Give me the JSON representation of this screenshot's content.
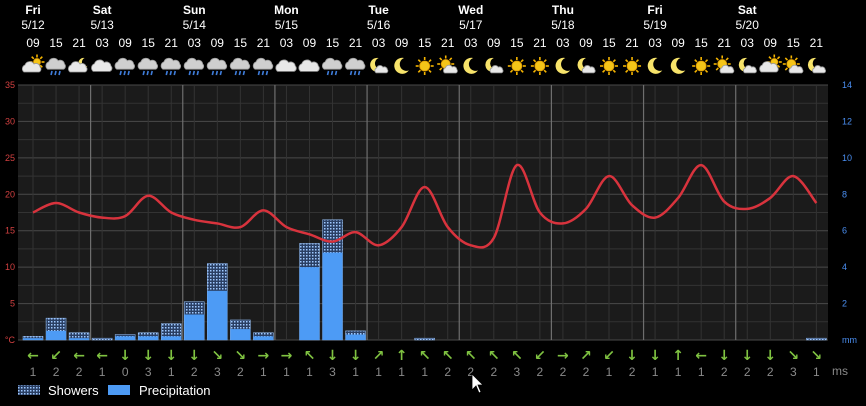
{
  "days": [
    {
      "name": "Fri",
      "date": "5/12"
    },
    {
      "name": "Sat",
      "date": "5/13"
    },
    {
      "name": "Sun",
      "date": "5/14"
    },
    {
      "name": "Mon",
      "date": "5/15"
    },
    {
      "name": "Tue",
      "date": "5/16"
    },
    {
      "name": "Wed",
      "date": "5/17"
    },
    {
      "name": "Thu",
      "date": "5/18"
    },
    {
      "name": "Fri",
      "date": "5/19"
    },
    {
      "name": "Sat",
      "date": "5/20"
    }
  ],
  "day_start_slot": [
    0,
    3,
    7,
    11,
    15,
    19,
    23,
    27,
    31
  ],
  "hours": [
    "09",
    "15",
    "21",
    "03",
    "09",
    "15",
    "21",
    "03",
    "09",
    "15",
    "21",
    "03",
    "09",
    "15",
    "21",
    "03",
    "09",
    "15",
    "21",
    "03",
    "09",
    "15",
    "21",
    "03",
    "09",
    "15",
    "21",
    "03",
    "09",
    "15",
    "21",
    "03",
    "09",
    "15",
    "21"
  ],
  "weather_icons": [
    "cloud-sun-icon",
    "cloud-rain-icon",
    "cloud-moon-icon",
    "cloud-icon",
    "cloud-rain-icon",
    "cloud-rain-icon",
    "cloud-rain-icon",
    "cloud-rain-icon",
    "cloud-rain-icon",
    "cloud-rain-icon",
    "cloud-rain-icon",
    "cloud-icon",
    "cloud-icon",
    "cloud-rain-icon",
    "cloud-rain-icon",
    "moon-cloud-icon",
    "moon-icon",
    "sun-icon",
    "sun-cloud-icon",
    "moon-icon",
    "moon-cloud-icon",
    "sun-icon",
    "sun-icon",
    "moon-icon",
    "moon-cloud-icon",
    "sun-icon",
    "sun-icon",
    "moon-icon",
    "moon-icon",
    "sun-icon",
    "sun-cloud-icon",
    "moon-cloud-icon",
    "cloud-sun-icon",
    "sun-cloud-icon",
    "moon-cloud-icon"
  ],
  "wind": {
    "arrows": [
      "←",
      "↙",
      "←",
      "←",
      "↓",
      "↓",
      "↓",
      "↓",
      "↘",
      "↘",
      "→",
      "→",
      "↖",
      "↓",
      "↓",
      "↗",
      "↑",
      "↖",
      "↖",
      "↖",
      "↖",
      "↖",
      "↙",
      "→",
      "↗",
      "↙",
      "↓",
      "↓",
      "↑",
      "←",
      "↓",
      "↓",
      "↓",
      "↘",
      "↘"
    ],
    "speeds": [
      1,
      2,
      2,
      1,
      0,
      3,
      1,
      2,
      3,
      2,
      1,
      1,
      1,
      3,
      1,
      1,
      1,
      1,
      2,
      2,
      2,
      3,
      2,
      2,
      2,
      1,
      2,
      1,
      1,
      1,
      2,
      2,
      2,
      3,
      1
    ],
    "unit": "ms"
  },
  "colors": {
    "temperature": "#d8333d",
    "precipitation": "#4d9bf5",
    "showers": "#9ec8ff",
    "wind_arrow": "#7fc241"
  },
  "legend": {
    "showers": "Showers",
    "precipitation": "Precipitation"
  },
  "chart_data": {
    "type": "line",
    "x": [
      "5/12 09",
      "5/12 15",
      "5/12 21",
      "5/13 03",
      "5/13 09",
      "5/13 15",
      "5/13 21",
      "5/14 03",
      "5/14 09",
      "5/14 15",
      "5/14 21",
      "5/15 03",
      "5/15 09",
      "5/15 15",
      "5/15 21",
      "5/16 03",
      "5/16 09",
      "5/16 15",
      "5/16 21",
      "5/17 03",
      "5/17 09",
      "5/17 15",
      "5/17 21",
      "5/18 03",
      "5/18 09",
      "5/18 15",
      "5/18 21",
      "5/19 03",
      "5/19 09",
      "5/19 15",
      "5/19 21",
      "5/20 03",
      "5/20 09",
      "5/20 15",
      "5/20 21"
    ],
    "temperature_c": [
      17.5,
      18.8,
      17.5,
      16.8,
      17.0,
      19.8,
      17.5,
      16.5,
      16.0,
      15.5,
      17.8,
      15.5,
      14.5,
      13.5,
      14.8,
      13.0,
      15.5,
      21.0,
      15.5,
      13.0,
      14.0,
      24.0,
      17.5,
      16.0,
      18.0,
      22.5,
      18.5,
      16.8,
      19.5,
      24.0,
      19.0,
      18.0,
      19.5,
      22.5,
      18.8
    ],
    "precipitation_mm": [
      0.1,
      0.5,
      0.1,
      0,
      0.2,
      0.2,
      0.2,
      1.4,
      2.7,
      0.6,
      0.2,
      0,
      4.0,
      4.8,
      0.3,
      0,
      0,
      0,
      0,
      0,
      0,
      0,
      0,
      0,
      0,
      0,
      0,
      0,
      0,
      0,
      0,
      0,
      0,
      0,
      0
    ],
    "showers_mm": [
      0.2,
      1.2,
      0.4,
      0.1,
      0.3,
      0.4,
      0.9,
      2.1,
      4.2,
      1.1,
      0.4,
      0,
      5.3,
      6.6,
      0.5,
      0,
      0,
      0.1,
      0,
      0,
      0,
      0,
      0,
      0,
      0,
      0,
      0,
      0,
      0,
      0,
      0,
      0,
      0,
      0,
      0.1
    ],
    "y_left": {
      "min": 0,
      "max": 35,
      "ticks": [
        0,
        5,
        10,
        15,
        20,
        25,
        30,
        35
      ],
      "unit": "°C"
    },
    "y_right": {
      "min": 0,
      "max": 14,
      "ticks": [
        0,
        2,
        4,
        6,
        8,
        10,
        12,
        14
      ],
      "unit": "mm"
    },
    "y_left_tick_labels": [
      "°C",
      "5",
      "10",
      "15",
      "20",
      "25",
      "30",
      "35"
    ],
    "y_right_tick_labels": [
      "mm",
      "2",
      "4",
      "6",
      "8",
      "10",
      "12",
      "14"
    ]
  }
}
